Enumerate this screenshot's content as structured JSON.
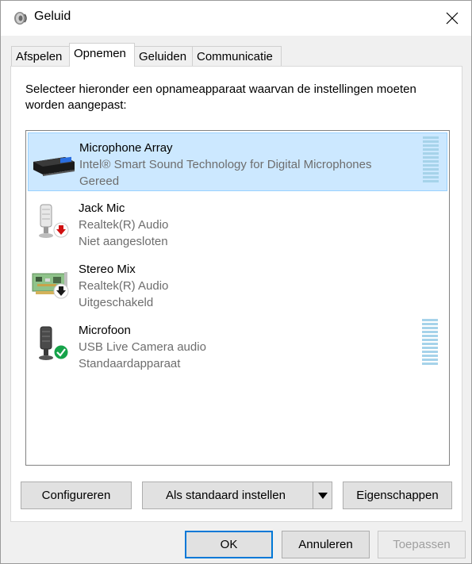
{
  "window": {
    "title": "Geluid",
    "icon": "speaker-icon",
    "close_icon": "close-icon"
  },
  "tabs": [
    {
      "label": "Afspelen",
      "active": false
    },
    {
      "label": "Opnemen",
      "active": true
    },
    {
      "label": "Geluiden",
      "active": false
    },
    {
      "label": "Communicatie",
      "active": false
    }
  ],
  "instructions": "Selecteer hieronder een opnameapparaat waarvan de instellingen moeten worden aangepast:",
  "devices": [
    {
      "name": "Microphone Array",
      "description": "Intel® Smart Sound Technology for Digital Microphones",
      "status": "Gereed",
      "icon": "microphone-array-icon",
      "selected": true,
      "level_meter": true
    },
    {
      "name": "Jack Mic",
      "description": "Realtek(R) Audio",
      "status": "Niet aangesloten",
      "icon": "microphone-icon",
      "badge": "unplugged-down-arrow-icon"
    },
    {
      "name": "Stereo Mix",
      "description": "Realtek(R) Audio",
      "status": "Uitgeschakeld",
      "icon": "sound-card-icon",
      "badge": "disabled-down-arrow-icon"
    },
    {
      "name": "Microfoon",
      "description": "USB Live Camera audio",
      "status": "Standaardapparaat",
      "icon": "microphone-icon",
      "badge": "default-check-icon",
      "level_meter": true
    }
  ],
  "buttons": {
    "configure": "Configureren",
    "set_default": "Als standaard instellen",
    "properties": "Eigenschappen",
    "ok": "OK",
    "cancel": "Annuleren",
    "apply": "Toepassen"
  },
  "colors": {
    "selection": "#cce8ff",
    "selection_border": "#99d1ff",
    "default_button_border": "#0078d7",
    "meter": "#a6d3ea"
  }
}
